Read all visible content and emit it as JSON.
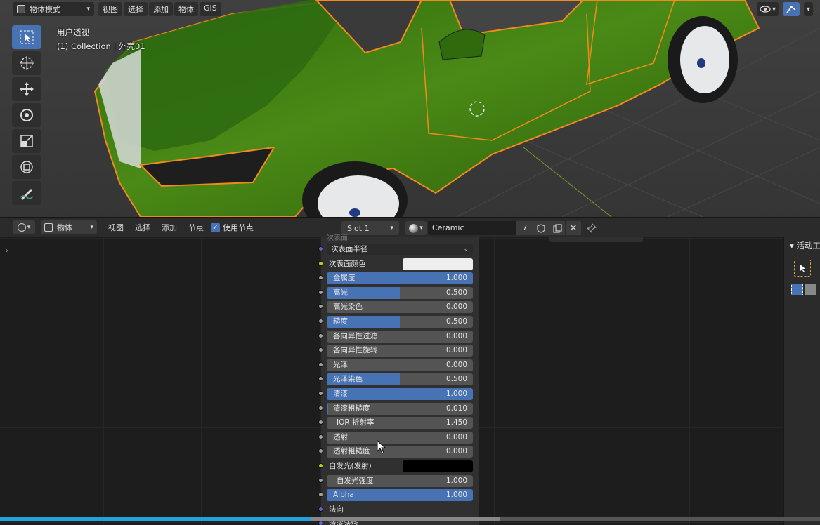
{
  "viewport": {
    "mode_label": "物体模式",
    "menu": [
      "视图",
      "选择",
      "添加",
      "物体",
      "GIS"
    ],
    "view_name": "用户透视",
    "collection_info": "(1) Collection | 外壳01",
    "tools": [
      {
        "name": "select-box",
        "active": true
      },
      {
        "name": "cursor",
        "active": false
      },
      {
        "name": "move",
        "active": false
      },
      {
        "name": "rotate",
        "active": false
      },
      {
        "name": "scale",
        "active": false
      },
      {
        "name": "transform",
        "active": false
      },
      {
        "name": "annotate",
        "active": false
      }
    ]
  },
  "node_header": {
    "object_label": "物体",
    "menu": [
      "视图",
      "选择",
      "添加",
      "节点"
    ],
    "use_nodes_label": "使用节点",
    "use_nodes_checked": true,
    "slot_label": "Slot 1",
    "material_name": "Ceramic",
    "user_count": "7"
  },
  "node": {
    "top_partial": "次表面",
    "rows": [
      {
        "kind": "dropdown",
        "label": "次表面半径",
        "socket": "purple"
      },
      {
        "kind": "color",
        "label": "次表面颜色",
        "socket": "yellow",
        "color": "#eeeeee"
      },
      {
        "kind": "slider",
        "label": "金属度",
        "value": "1.000",
        "fill": 1.0,
        "socket": "grey"
      },
      {
        "kind": "slider",
        "label": "高光",
        "value": "0.500",
        "fill": 0.5,
        "socket": "grey"
      },
      {
        "kind": "slider",
        "label": "高光染色",
        "value": "0.000",
        "fill": 0,
        "socket": "grey"
      },
      {
        "kind": "slider",
        "label": "糙度",
        "value": "0.500",
        "fill": 0.5,
        "socket": "grey"
      },
      {
        "kind": "slider",
        "label": "各向异性过滤",
        "value": "0.000",
        "fill": 0,
        "socket": "grey"
      },
      {
        "kind": "slider",
        "label": "各向异性旋转",
        "value": "0.000",
        "fill": 0,
        "socket": "grey"
      },
      {
        "kind": "slider",
        "label": "光泽",
        "value": "0.000",
        "fill": 0,
        "socket": "grey"
      },
      {
        "kind": "slider",
        "label": "光泽染色",
        "value": "0.500",
        "fill": 0.5,
        "socket": "grey"
      },
      {
        "kind": "slider",
        "label": "清漆",
        "value": "1.000",
        "fill": 1.0,
        "socket": "grey"
      },
      {
        "kind": "slider",
        "label": "清漆粗糙度",
        "value": "0.010",
        "fill": 0.01,
        "socket": "grey"
      },
      {
        "kind": "slider",
        "label": "IOR 折射率",
        "value": "1.450",
        "fill": 0,
        "socket": "grey",
        "indent": true
      },
      {
        "kind": "slider",
        "label": "透射",
        "value": "0.000",
        "fill": 0,
        "socket": "grey"
      },
      {
        "kind": "slider",
        "label": "透射粗糙度",
        "value": "0.000",
        "fill": 0,
        "socket": "grey"
      },
      {
        "kind": "color",
        "label": "自发光(发射)",
        "socket": "yellow",
        "color": "#000000"
      },
      {
        "kind": "slider",
        "label": "自发光强度",
        "value": "1.000",
        "fill": 0,
        "socket": "grey",
        "indent": true
      },
      {
        "kind": "slider",
        "label": "Alpha",
        "value": "1.000",
        "fill": 1.0,
        "socket": "grey"
      },
      {
        "kind": "text",
        "label": "法向",
        "socket": "purple"
      },
      {
        "kind": "text",
        "label": "清漆法线",
        "socket": "purple"
      }
    ]
  },
  "sidebar": {
    "title": "活动工具"
  },
  "progress": {
    "played": 0.38,
    "buffered": 0.61
  },
  "colors": {
    "accent": "#4772b3",
    "selection_outline": "#f28a1d",
    "car_paint": "#3d7a12",
    "socket_grey": "#a1a1a1",
    "socket_yellow": "#c7c729",
    "socket_purple": "#6363c7"
  }
}
